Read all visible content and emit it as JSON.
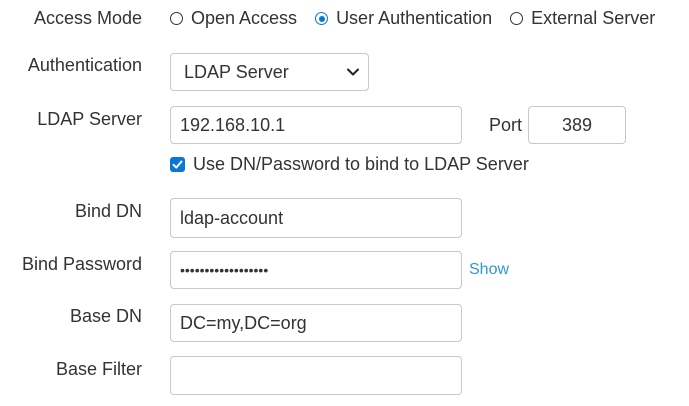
{
  "access_mode": {
    "label": "Access Mode",
    "options": [
      {
        "label": "Open Access",
        "checked": false
      },
      {
        "label": "User Authentication",
        "checked": true
      },
      {
        "label": "External Server",
        "checked": false
      }
    ]
  },
  "authentication": {
    "label": "Authentication",
    "selected": "LDAP Server"
  },
  "ldap_server": {
    "label": "LDAP Server",
    "value": "192.168.10.1",
    "port_label": "Port",
    "port_value": "389"
  },
  "bind_checkbox": {
    "label": "Use DN/Password to bind to LDAP Server",
    "checked": true
  },
  "bind_dn": {
    "label": "Bind DN",
    "value": "ldap-account"
  },
  "bind_password": {
    "label": "Bind Password",
    "value": "••••••••••••••••••",
    "show_label": "Show"
  },
  "base_dn": {
    "label": "Base DN",
    "value": "DC=my,DC=org"
  },
  "base_filter": {
    "label": "Base Filter",
    "value": ""
  },
  "colors": {
    "accent": "#0b76d6",
    "link": "#2e9ad0",
    "border": "#c8c8c8",
    "text": "#333333"
  }
}
